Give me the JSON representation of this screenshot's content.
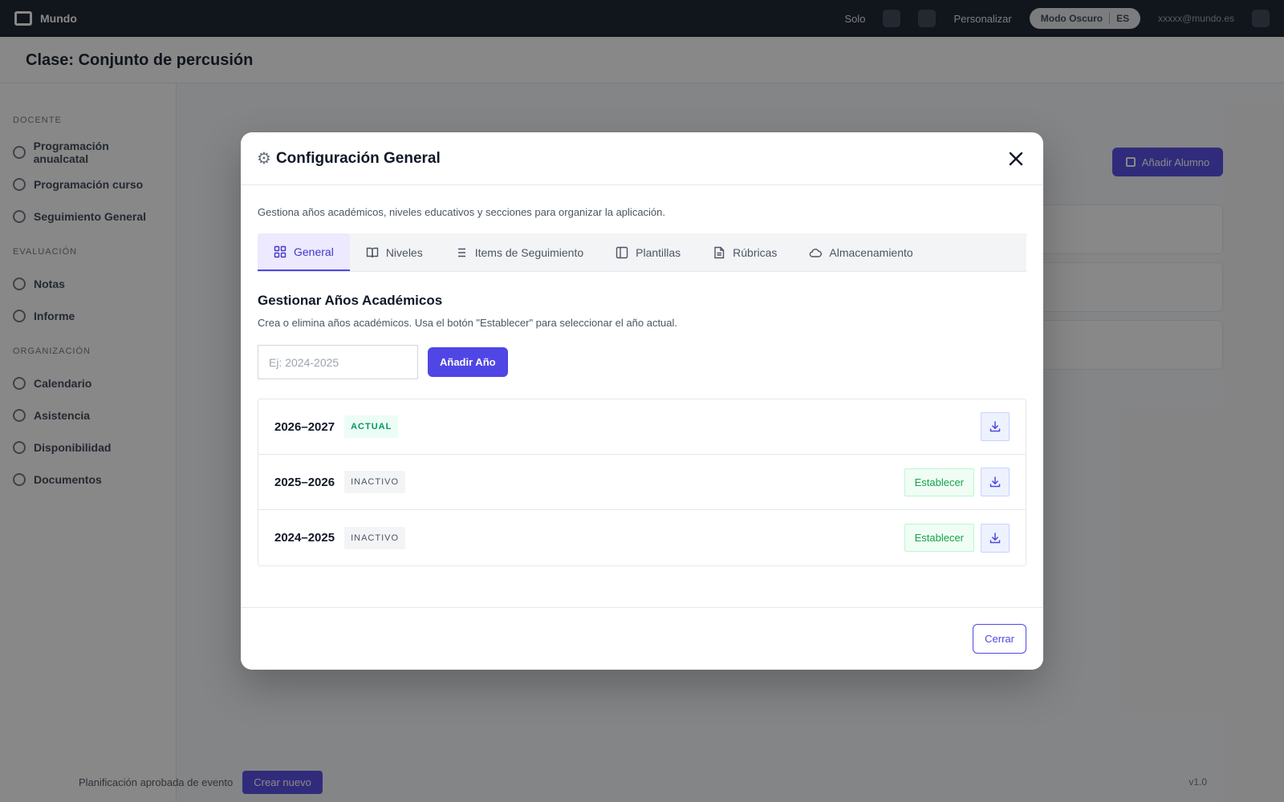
{
  "app": {
    "brand": "Mundo",
    "topbar": {
      "items": [
        "Solo",
        "Personalizar"
      ],
      "pill": "Modo Oscuro",
      "pill_extra": "ES",
      "email": "xxxxx@mundo.es"
    },
    "header_title": "Clase: Conjunto de percusión",
    "sidebar": [
      {
        "section": "Docente",
        "items": [
          "Programación anualcatal",
          "Programación curso",
          "Seguimiento General"
        ]
      },
      {
        "section": "Evaluación",
        "items": [
          "Notas",
          "Informe"
        ]
      },
      {
        "section": "Organización",
        "items": [
          "Calendario",
          "Asistencia",
          "Disponibilidad",
          "Documentos"
        ]
      }
    ],
    "bg_button": "Añadir Alumno",
    "footer": {
      "text": "Planificación aprobada de evento",
      "button": "Crear nuevo",
      "version": "v1.0"
    }
  },
  "modal": {
    "title": "Configuración General",
    "title_icon": "gear-icon",
    "description": "Gestiona años académicos, niveles educativos y secciones para organizar la aplicación.",
    "tabs": [
      {
        "label": "General",
        "icon": "grid-icon",
        "active": true
      },
      {
        "label": "Niveles",
        "icon": "book-icon",
        "active": false
      },
      {
        "label": "Items de Seguimiento",
        "icon": "list-icon",
        "active": false
      },
      {
        "label": "Plantillas",
        "icon": "layout-icon",
        "active": false
      },
      {
        "label": "Rúbricas",
        "icon": "file-text-icon",
        "active": false
      },
      {
        "label": "Almacenamiento",
        "icon": "cloud-icon",
        "active": false
      }
    ],
    "section_title": "Gestionar Años Académicos",
    "section_description": "Crea o elimina años académicos. Usa el botón \"Establecer\" para seleccionar el año actual.",
    "input": {
      "value": "",
      "placeholder": "Ej: 2024-2025"
    },
    "add_button": "Añadir Año",
    "years": [
      {
        "label": "2026–2027",
        "status": "ACTUAL",
        "set_label": ""
      },
      {
        "label": "2025–2026",
        "status": "INACTIVO",
        "set_label": "Establecer"
      },
      {
        "label": "2024–2025",
        "status": "INACTIVO",
        "set_label": "Establecer"
      }
    ],
    "close_button": "Cerrar",
    "colors": {
      "accent": "#4f46e5",
      "success": "#16a34a"
    }
  }
}
